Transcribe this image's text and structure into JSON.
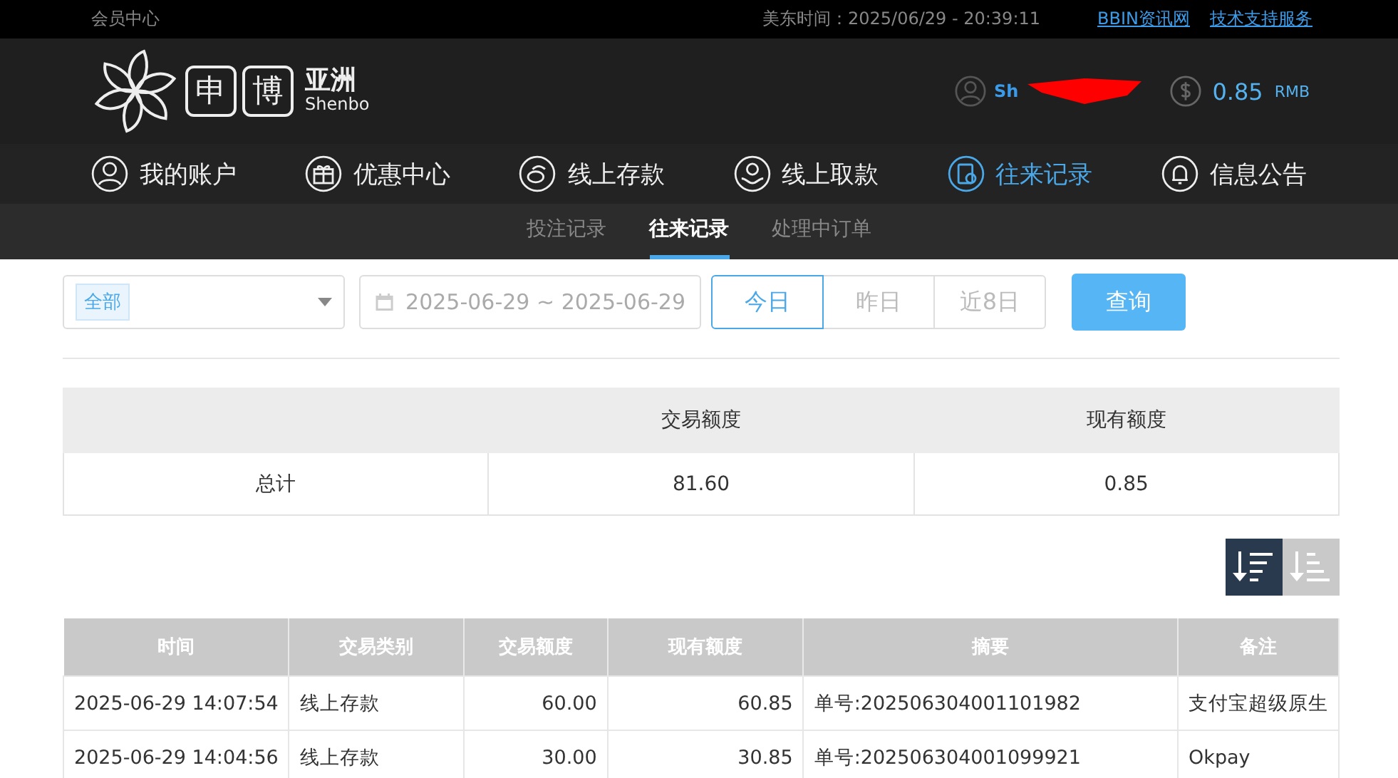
{
  "top_bar": {
    "title": "会员中心",
    "time": "美东时间：2025/06/29 - 20:39:11",
    "links": [
      "BBIN资讯网",
      "技术支持服务"
    ]
  },
  "header": {
    "logo": {
      "chars": [
        "申",
        "博"
      ],
      "name": "亚洲",
      "sub": "Shenbo"
    },
    "username": "Sh",
    "balance": "0.85",
    "currency": "RMB"
  },
  "nav": [
    {
      "label": "我的账户",
      "selected": false
    },
    {
      "label": "优惠中心",
      "selected": false
    },
    {
      "label": "线上存款",
      "selected": false
    },
    {
      "label": "线上取款",
      "selected": false
    },
    {
      "label": "往来记录",
      "selected": true
    },
    {
      "label": "信息公告",
      "selected": false
    }
  ],
  "sub_nav": [
    {
      "label": "投注记录",
      "selected": false
    },
    {
      "label": "往来记录",
      "selected": true
    },
    {
      "label": "处理中订单",
      "selected": false
    }
  ],
  "filters": {
    "type_tag": "全部",
    "date_range": "2025-06-29 ~ 2025-06-29",
    "quick_ranges": [
      {
        "label": "今日",
        "selected": true
      },
      {
        "label": "昨日",
        "selected": false
      },
      {
        "label": "近8日",
        "selected": false
      }
    ],
    "query_button": "查询"
  },
  "summary": {
    "columns": [
      "交易额度",
      "现有额度"
    ],
    "row": {
      "label": "总计",
      "values": [
        "81.60",
        "0.85"
      ]
    }
  },
  "sort_buttons": [
    {
      "kind": "desc",
      "selected": true
    },
    {
      "kind": "asc",
      "selected": false
    }
  ],
  "table": {
    "columns": [
      "时间",
      "交易类别",
      "交易额度",
      "现有额度",
      "摘要",
      "备注"
    ],
    "rows": [
      [
        "2025-06-29 14:07:54",
        "线上存款",
        "60.00",
        "60.85",
        "单号:202506304001101982",
        "支付宝超级原生"
      ],
      [
        "2025-06-29 14:04:56",
        "线上存款",
        "30.00",
        "30.85",
        "单号:202506304001099921",
        "Okpay"
      ]
    ]
  }
}
